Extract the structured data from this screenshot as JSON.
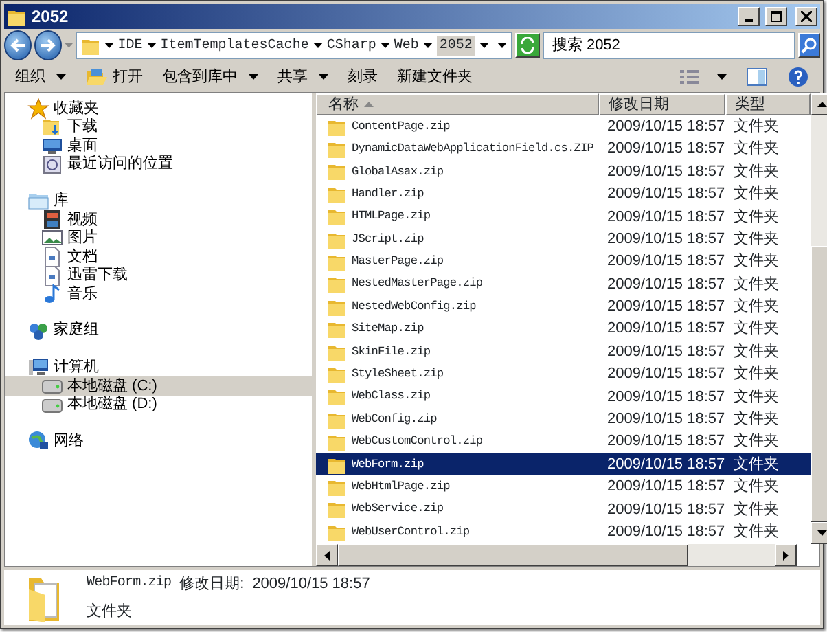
{
  "window": {
    "title": "2052"
  },
  "address": {
    "crumbs": [
      "IDE",
      "ItemTemplatesCache",
      "CSharp",
      "Web",
      "2052"
    ],
    "search_placeholder": "搜索 2052"
  },
  "toolbar": [
    {
      "label": "组织",
      "dropdown": true,
      "kind": "plain"
    },
    {
      "label": "打开",
      "dropdown": false,
      "kind": "open"
    },
    {
      "label": "包含到库中",
      "dropdown": true,
      "kind": "plain"
    },
    {
      "label": "共享",
      "dropdown": true,
      "kind": "plain"
    },
    {
      "label": "刻录",
      "dropdown": false,
      "kind": "plain"
    },
    {
      "label": "新建文件夹",
      "dropdown": false,
      "kind": "plain"
    }
  ],
  "sidebar": [
    {
      "label": "收藏夹",
      "kind": "star",
      "selected": false,
      "children": [
        {
          "label": "下载",
          "kind": "download",
          "selected": false
        },
        {
          "label": "桌面",
          "kind": "desktop",
          "selected": false
        },
        {
          "label": "最近访问的位置",
          "kind": "recent",
          "selected": false
        }
      ]
    },
    {
      "label": "库",
      "kind": "library",
      "selected": false,
      "children": [
        {
          "label": "视频",
          "kind": "video",
          "selected": false
        },
        {
          "label": "图片",
          "kind": "picture",
          "selected": false
        },
        {
          "label": "文档",
          "kind": "document",
          "selected": false
        },
        {
          "label": "迅雷下载",
          "kind": "document",
          "selected": false
        },
        {
          "label": "音乐",
          "kind": "music",
          "selected": false
        }
      ]
    },
    {
      "label": "家庭组",
      "kind": "homegroup",
      "selected": false
    },
    {
      "label": "计算机",
      "kind": "computer",
      "selected": false,
      "children": [
        {
          "label": "本地磁盘 (C:)",
          "kind": "drive",
          "selected": true
        },
        {
          "label": "本地磁盘 (D:)",
          "kind": "drive",
          "selected": false
        }
      ]
    },
    {
      "label": "网络",
      "kind": "network",
      "selected": false
    }
  ],
  "files": {
    "columns": [
      {
        "label": "名称",
        "sorted": true
      },
      {
        "label": "修改日期",
        "sorted": false
      },
      {
        "label": "类型",
        "sorted": false
      }
    ],
    "rows": [
      {
        "name": "ContentPage.zip",
        "date": "2009/10/15 18:57",
        "type": "文件夹",
        "selected": false
      },
      {
        "name": "DynamicDataWebApplicationField.cs.ZIP",
        "date": "2009/10/15 18:57",
        "type": "文件夹",
        "selected": false
      },
      {
        "name": "GlobalAsax.zip",
        "date": "2009/10/15 18:57",
        "type": "文件夹",
        "selected": false
      },
      {
        "name": "Handler.zip",
        "date": "2009/10/15 18:57",
        "type": "文件夹",
        "selected": false
      },
      {
        "name": "HTMLPage.zip",
        "date": "2009/10/15 18:57",
        "type": "文件夹",
        "selected": false
      },
      {
        "name": "JScript.zip",
        "date": "2009/10/15 18:57",
        "type": "文件夹",
        "selected": false
      },
      {
        "name": "MasterPage.zip",
        "date": "2009/10/15 18:57",
        "type": "文件夹",
        "selected": false
      },
      {
        "name": "NestedMasterPage.zip",
        "date": "2009/10/15 18:57",
        "type": "文件夹",
        "selected": false
      },
      {
        "name": "NestedWebConfig.zip",
        "date": "2009/10/15 18:57",
        "type": "文件夹",
        "selected": false
      },
      {
        "name": "SiteMap.zip",
        "date": "2009/10/15 18:57",
        "type": "文件夹",
        "selected": false
      },
      {
        "name": "SkinFile.zip",
        "date": "2009/10/15 18:57",
        "type": "文件夹",
        "selected": false
      },
      {
        "name": "StyleSheet.zip",
        "date": "2009/10/15 18:57",
        "type": "文件夹",
        "selected": false
      },
      {
        "name": "WebClass.zip",
        "date": "2009/10/15 18:57",
        "type": "文件夹",
        "selected": false
      },
      {
        "name": "WebConfig.zip",
        "date": "2009/10/15 18:57",
        "type": "文件夹",
        "selected": false
      },
      {
        "name": "WebCustomControl.zip",
        "date": "2009/10/15 18:57",
        "type": "文件夹",
        "selected": false
      },
      {
        "name": "WebForm.zip",
        "date": "2009/10/15 18:57",
        "type": "文件夹",
        "selected": true
      },
      {
        "name": "WebHtmlPage.zip",
        "date": "2009/10/15 18:57",
        "type": "文件夹",
        "selected": false
      },
      {
        "name": "WebService.zip",
        "date": "2009/10/15 18:57",
        "type": "文件夹",
        "selected": false
      },
      {
        "name": "WebUserControl.zip",
        "date": "2009/10/15 18:57",
        "type": "文件夹",
        "selected": false
      }
    ]
  },
  "details": {
    "name": "WebForm.zip",
    "date_label": "修改日期:",
    "date": "2009/10/15 18:57",
    "type": "文件夹"
  }
}
